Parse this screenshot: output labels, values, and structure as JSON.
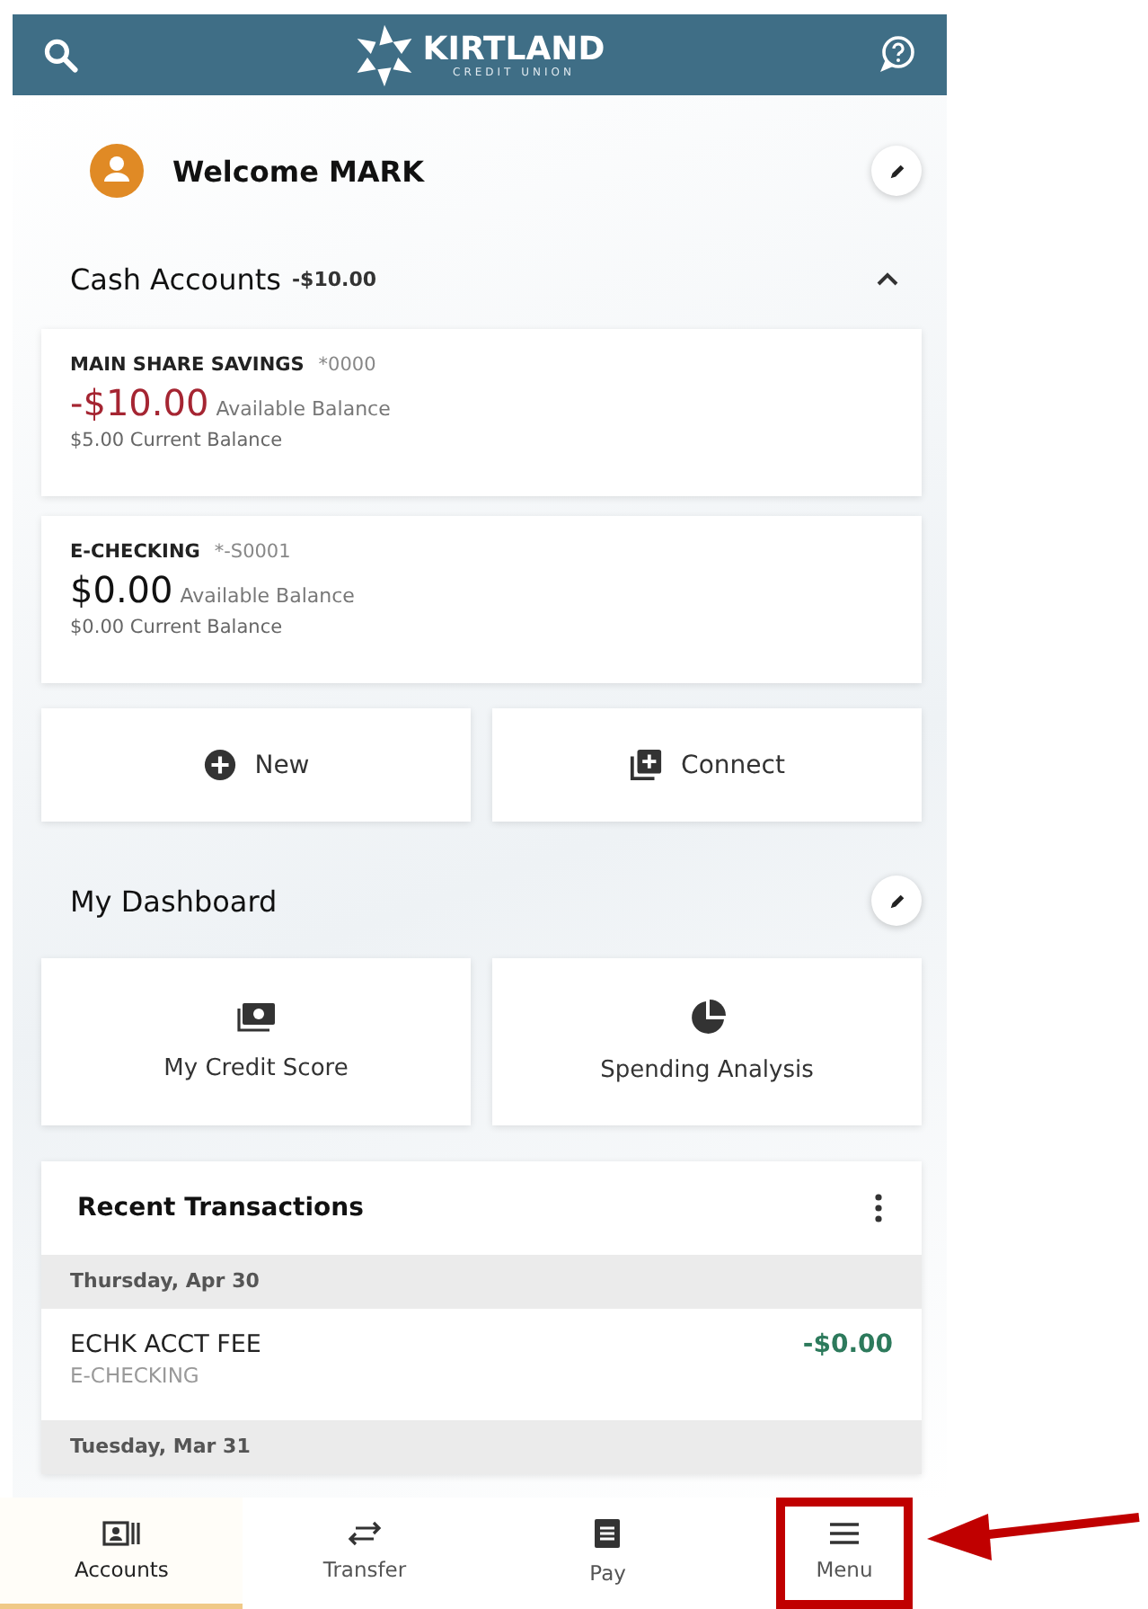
{
  "header": {
    "brand": "KIRTLAND",
    "brand_sub": "CREDIT UNION"
  },
  "welcome": {
    "text": "Welcome MARK"
  },
  "cash_accounts": {
    "title": "Cash Accounts",
    "total": "-$10.00",
    "expanded": true,
    "accounts": [
      {
        "name": "MAIN SHARE SAVINGS",
        "number": "*0000",
        "available": "-$10.00",
        "negative": true,
        "available_label": "Available Balance",
        "current": "$5.00 Current Balance"
      },
      {
        "name": "E-CHECKING",
        "number": "*-S0001",
        "available": "$0.00",
        "negative": false,
        "available_label": "Available Balance",
        "current": "$0.00 Current Balance"
      }
    ]
  },
  "account_actions": [
    {
      "label": "New",
      "kind": "new"
    },
    {
      "label": "Connect",
      "kind": "connect"
    }
  ],
  "dashboard": {
    "title": "My Dashboard",
    "tiles": [
      {
        "label": "My Credit Score",
        "kind": "credit"
      },
      {
        "label": "Spending Analysis",
        "kind": "spending"
      }
    ]
  },
  "recent_transactions": {
    "title": "Recent Transactions",
    "groups": [
      {
        "date": "Thursday, Apr 30",
        "items": [
          {
            "description": "ECHK ACCT FEE",
            "account": "E-CHECKING",
            "amount": "-$0.00"
          }
        ]
      },
      {
        "date": "Tuesday, Mar 31"
      }
    ]
  },
  "bottom_nav": [
    {
      "label": "Accounts",
      "kind": "accounts",
      "selected": true,
      "highlighted": false
    },
    {
      "label": "Transfer",
      "kind": "transfer",
      "selected": false,
      "highlighted": false
    },
    {
      "label": "Pay",
      "kind": "pay",
      "selected": false,
      "highlighted": false
    },
    {
      "label": "Menu",
      "kind": "menu",
      "selected": false,
      "highlighted": true
    }
  ]
}
